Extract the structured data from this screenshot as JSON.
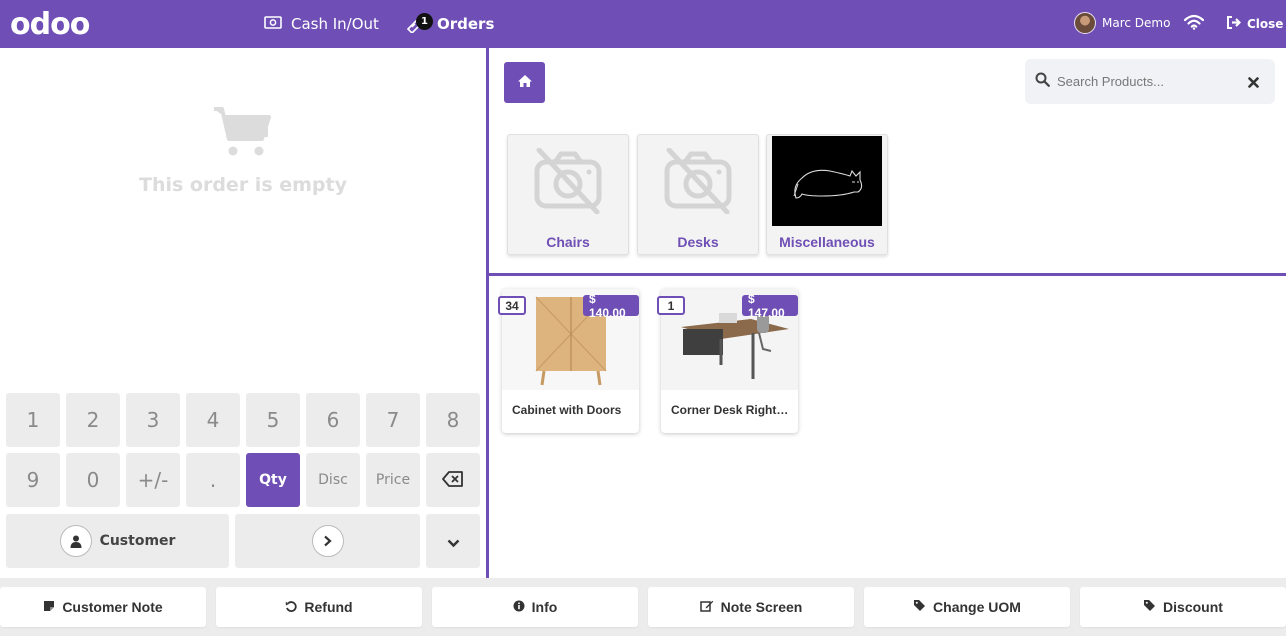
{
  "topbar": {
    "logo": "odoo",
    "cash_label": "Cash In/Out",
    "orders_label": "Orders",
    "orders_count": "1",
    "user_name": "Marc Demo",
    "close_label": "Close"
  },
  "order": {
    "empty_text": "This order is empty"
  },
  "numpad": {
    "row1": [
      "1",
      "2",
      "3",
      "4",
      "5",
      "6",
      "7",
      "8"
    ],
    "row2": [
      "9",
      "0",
      "+/-",
      ".",
      "Qty",
      "Disc",
      "Price"
    ],
    "customer_label": "Customer"
  },
  "search": {
    "placeholder": "Search Products..."
  },
  "categories": [
    {
      "name": "Chairs",
      "icon": "no-image-icon"
    },
    {
      "name": "Desks",
      "icon": "no-image-icon"
    },
    {
      "name": "Miscellaneous",
      "icon": "cat-drawing-image"
    }
  ],
  "products": [
    {
      "name": "Cabinet with Doors",
      "qty": "34",
      "price": "$ 140.00"
    },
    {
      "name": "Corner Desk Right…",
      "qty": "1",
      "price": "$ 147.00"
    }
  ],
  "controls": [
    {
      "label": "Customer Note",
      "icon": "sticky-note-icon"
    },
    {
      "label": "Refund",
      "icon": "undo-icon"
    },
    {
      "label": "Info",
      "icon": "info-icon"
    },
    {
      "label": "Note Screen",
      "icon": "edit-icon"
    },
    {
      "label": "Change UOM",
      "icon": "tag-icon"
    },
    {
      "label": "Discount",
      "icon": "tag-icon"
    }
  ],
  "colors": {
    "accent": "#6f4fb5",
    "key_bg": "#ececec"
  }
}
